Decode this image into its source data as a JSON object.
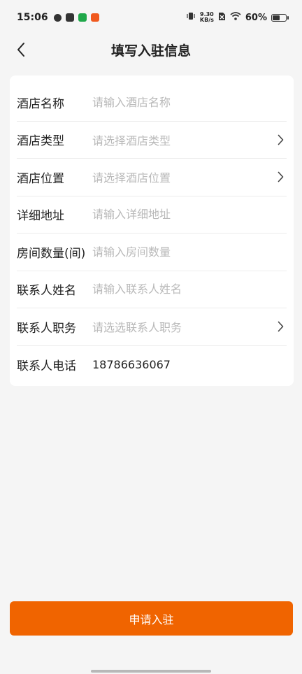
{
  "status_bar": {
    "time": "15:06",
    "speed_value": "9.30",
    "speed_unit": "KB/s",
    "battery_percent": "60%",
    "battery_level": 0.6
  },
  "nav": {
    "title": "填写入驻信息"
  },
  "form": {
    "rows": [
      {
        "label": "酒店名称",
        "placeholder": "请输入酒店名称"
      },
      {
        "label": "酒店类型",
        "placeholder": "请选择酒店类型"
      },
      {
        "label": "酒店位置",
        "placeholder": "请选择酒店位置"
      },
      {
        "label": "详细地址",
        "placeholder": "请输入详细地址"
      },
      {
        "label": "房间数量(间)",
        "placeholder": "请输入房间数量"
      },
      {
        "label": "联系人姓名",
        "placeholder": "请输入联系人姓名"
      },
      {
        "label": "联系人职务",
        "placeholder": "请选选联系人职务"
      },
      {
        "label": "联系人电话",
        "value": "18786636067"
      }
    ]
  },
  "submit": {
    "label": "申请入驻",
    "color": "#f06400"
  }
}
